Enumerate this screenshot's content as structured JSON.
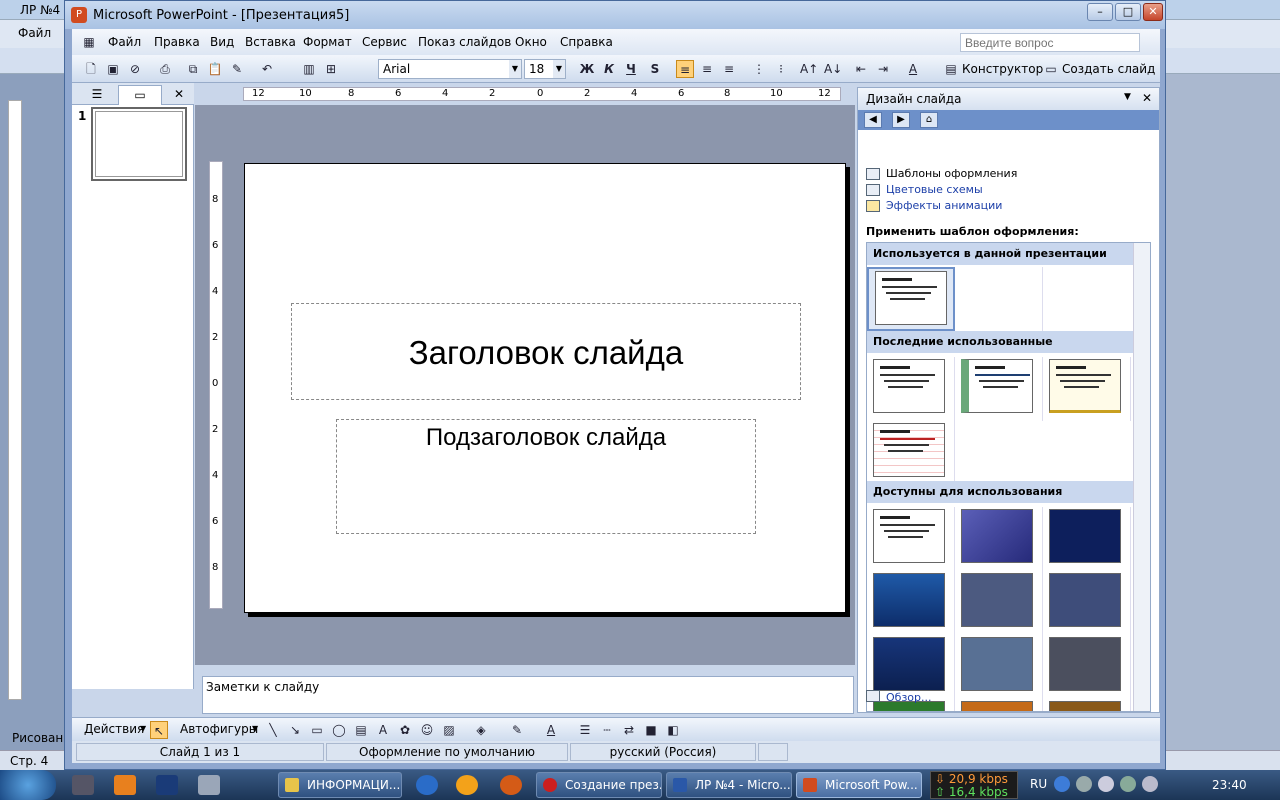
{
  "background": {
    "title": "ЛР №4",
    "menu_file": "Файл",
    "left_tab": "Рисован",
    "status": "Стр. 4"
  },
  "window": {
    "title": "Microsoft PowerPoint - [Презентация5]",
    "min_label": "–",
    "max_label": "□",
    "close_label": "✕"
  },
  "menu": {
    "items": [
      "Файл",
      "Правка",
      "Вид",
      "Вставка",
      "Формат",
      "Сервис",
      "Показ слайдов",
      "Окно",
      "Справка"
    ],
    "question_placeholder": "Введите вопрос"
  },
  "toolbar": {
    "font": "Arial",
    "size": "18",
    "bold": "Ж",
    "italic": "К",
    "underline": "Ч",
    "shadow": "S",
    "designer": "Конструктор",
    "new_slide": "Создать слайд"
  },
  "left_pane": {
    "slide_number": "1"
  },
  "ruler": {
    "h_ticks": [
      "12",
      "10",
      "8",
      "6",
      "4",
      "2",
      "0",
      "2",
      "4",
      "6",
      "8",
      "10",
      "12"
    ],
    "v_ticks": [
      "8",
      "6",
      "4",
      "2",
      "0",
      "2",
      "4",
      "6",
      "8"
    ]
  },
  "slide": {
    "title": "Заголовок слайда",
    "subtitle": "Подзаголовок слайда"
  },
  "notes": {
    "placeholder": "Заметки к слайду"
  },
  "task_pane": {
    "title": "Дизайн слайда",
    "links": [
      "Шаблоны оформления",
      "Цветовые схемы",
      "Эффекты анимации"
    ],
    "apply_label": "Применить шаблон оформления:",
    "section_used": "Используется в данной презентации",
    "section_recent": "Последние использованные",
    "section_available": "Доступны для использования",
    "browse": "Обзор..."
  },
  "drawbar": {
    "actions": "Действия",
    "autoshapes": "Автофигуры"
  },
  "status": {
    "slide": "Слайд 1 из 1",
    "design": "Оформление по умолчанию",
    "language": "русский (Россия)"
  },
  "taskbar": {
    "items": [
      "ИНФОРМАЦИ...",
      "Создание през...",
      "ЛР №4 - Micro...",
      "Microsoft Pow..."
    ],
    "net_down": "20,9 kbps",
    "net_up": "16,4 kbps",
    "lang": "RU",
    "time": "23:40"
  },
  "colors": {
    "accent": "#6d90c9",
    "link": "#1c3fa8",
    "section": "#c9d7ee",
    "stage": "#8c96ac"
  }
}
